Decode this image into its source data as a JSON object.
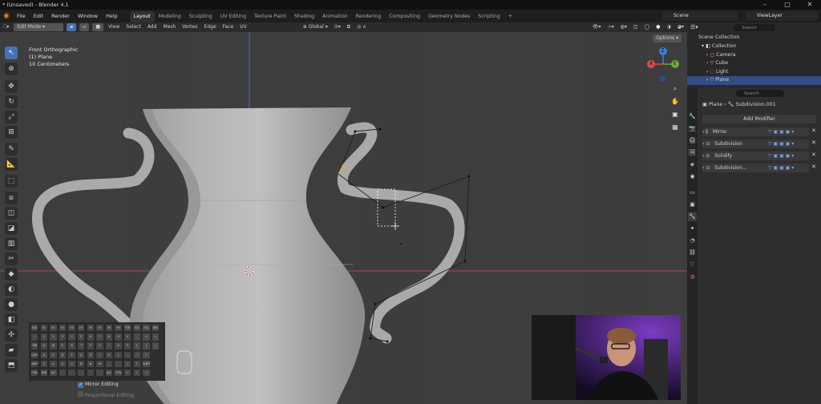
{
  "window": {
    "title": "* (Unsaved) - Blender 4.1"
  },
  "menu": {
    "items": [
      "File",
      "Edit",
      "Render",
      "Window",
      "Help"
    ]
  },
  "workspaces": [
    "Layout",
    "Modeling",
    "Sculpting",
    "UV Editing",
    "Texture Paint",
    "Shading",
    "Animation",
    "Rendering",
    "Compositing",
    "Geometry Nodes",
    "Scripting"
  ],
  "active_workspace": "Layout",
  "scene": {
    "name": "Scene",
    "view_layer": "ViewLayer"
  },
  "header": {
    "mode": "Edit Mode",
    "menus": [
      "View",
      "Select",
      "Add",
      "Mesh",
      "Vertex",
      "Edge",
      "Face",
      "UV"
    ],
    "orientation": "Global",
    "options": "Options"
  },
  "viewport": {
    "view_name": "Front Orthographic",
    "object": "(1) Plane",
    "scale": "10 Centimeters",
    "gizmo": {
      "z": "Z",
      "y": "Y",
      "x": "X"
    }
  },
  "outliner": {
    "root": "Scene Collection",
    "collection": "Collection",
    "items": [
      "Camera",
      "Cube",
      "Light",
      "Plane"
    ],
    "search_placeholder": "Search"
  },
  "properties": {
    "object": "Plane",
    "modifier": "Subdivision.001",
    "search_placeholder": "Search",
    "add_modifier": "Add Modifier",
    "modifiers": [
      "Mirror",
      "Subdivision",
      "Solidify",
      "Subdivision..."
    ]
  },
  "keyboard": {
    "rows": [
      [
        "ESC",
        "F1",
        "F2",
        "F3",
        "F4",
        "F5",
        "F6",
        "F7",
        "F8",
        "F9",
        "F10",
        "F11",
        "F12",
        "DEL"
      ],
      [
        "~",
        "1",
        "2",
        "3",
        "4",
        "5",
        "6",
        "7",
        "8",
        "9",
        "0",
        "-",
        "=",
        "←"
      ],
      [
        "TAB",
        "Q",
        "W",
        "E",
        "R",
        "T",
        "Y",
        "U",
        "I",
        "O",
        "P",
        "[",
        "]",
        "\\"
      ],
      [
        "CAPS",
        "A",
        "S",
        "D",
        "F",
        "G",
        "H",
        "J",
        "K",
        "L",
        ";",
        "'",
        "↵"
      ],
      [
        "SHIFT",
        "Z",
        "X",
        "C",
        "V",
        "B",
        "N",
        "M",
        ",",
        ".",
        "/",
        "↑",
        "SHIFT"
      ],
      [
        "CTRL",
        "WIN",
        "ALT",
        "",
        "",
        "",
        "",
        "",
        "ALT",
        "CTRL",
        "←",
        "↓",
        "→"
      ]
    ],
    "options": [
      "Mirror Editing",
      "Proportional Editing"
    ]
  },
  "colors": {
    "accent": "#4772b3",
    "selected_row": "#334d80",
    "x_axis": "#d64d4d",
    "y_axis": "#6ea832",
    "z_axis": "#3b82d6",
    "vertex_selected": "#f0a040"
  }
}
